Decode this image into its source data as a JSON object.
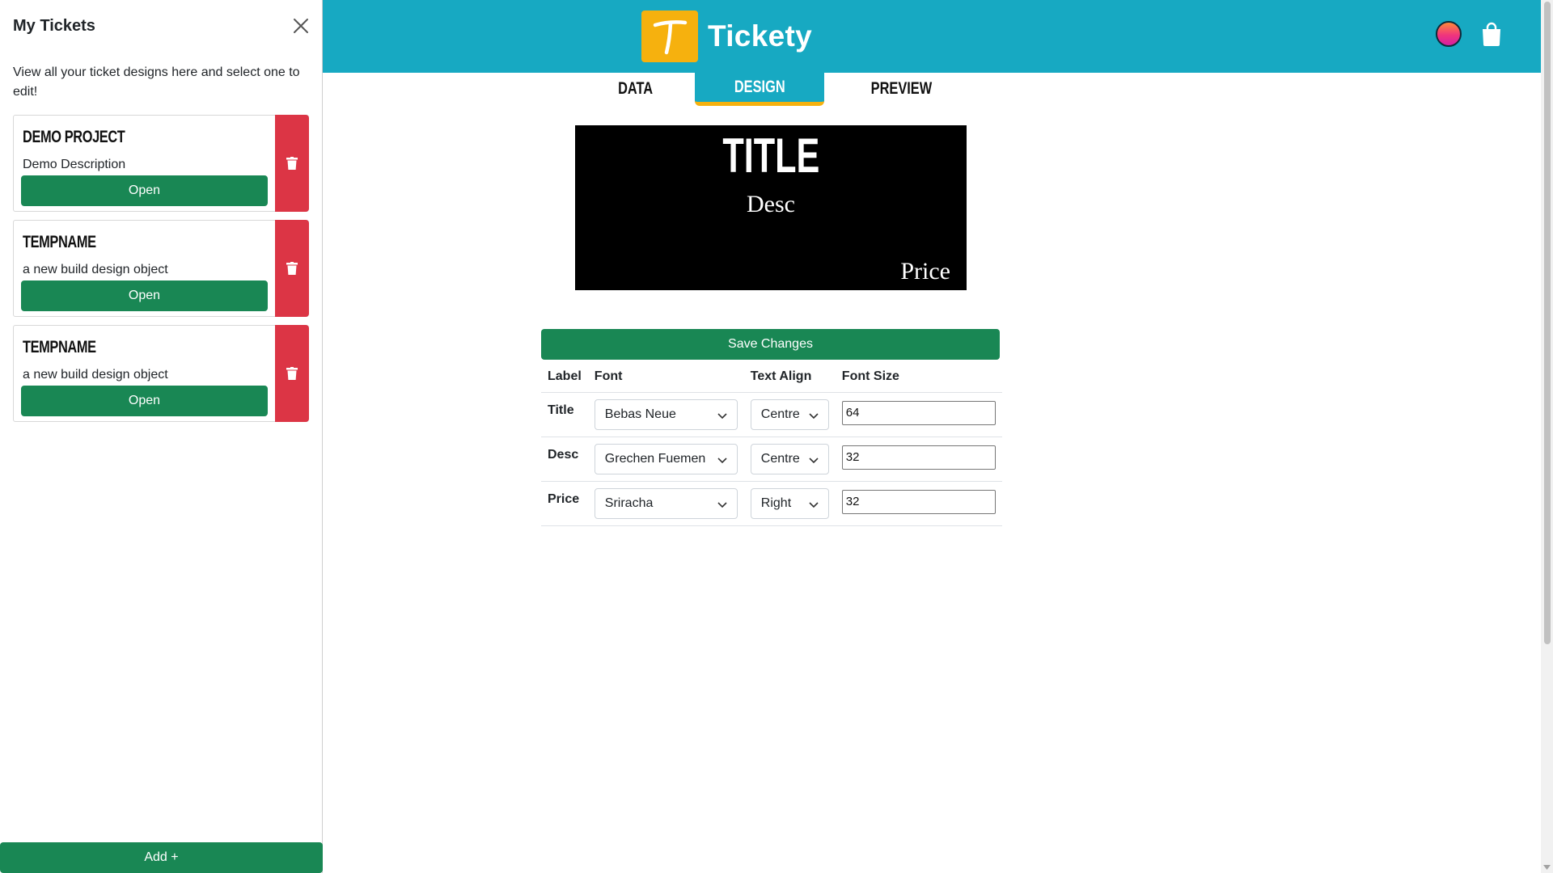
{
  "sidebar": {
    "title": "My Tickets",
    "intro": "View all your ticket designs here and select one to edit!",
    "tickets": [
      {
        "name": "DEMO PROJECT",
        "description": "Demo Description",
        "open_label": "Open"
      },
      {
        "name": "TEMPNAME",
        "description": "a new build design object",
        "open_label": "Open"
      },
      {
        "name": "TEMPNAME",
        "description": "a new build design object",
        "open_label": "Open"
      }
    ],
    "add_label": "Add +"
  },
  "header": {
    "brand": "Tickety",
    "logo_letter": "T",
    "icons": [
      "avatar",
      "shopping-bag-icon"
    ]
  },
  "tabs": [
    {
      "label": "DATA",
      "active": false
    },
    {
      "label": "DESIGN",
      "active": true
    },
    {
      "label": "PREVIEW",
      "active": false
    }
  ],
  "preview": {
    "title": "TITLE",
    "desc": "Desc",
    "price": "Price"
  },
  "editor": {
    "save_label": "Save Changes",
    "columns": [
      "Label",
      "Font",
      "Text Align",
      "Font Size"
    ],
    "rows": [
      {
        "label": "Title",
        "font": "Bebas Neue",
        "align": "Centre",
        "size": "64"
      },
      {
        "label": "Desc",
        "font": "Grechen Fuemen",
        "align": "Centre",
        "size": "32"
      },
      {
        "label": "Price",
        "font": "Sriracha",
        "align": "Right",
        "size": "32"
      }
    ]
  },
  "colors": {
    "header": "#17a9c2",
    "accent": "#f6b10e",
    "success": "#198754",
    "danger": "#dc3545"
  }
}
